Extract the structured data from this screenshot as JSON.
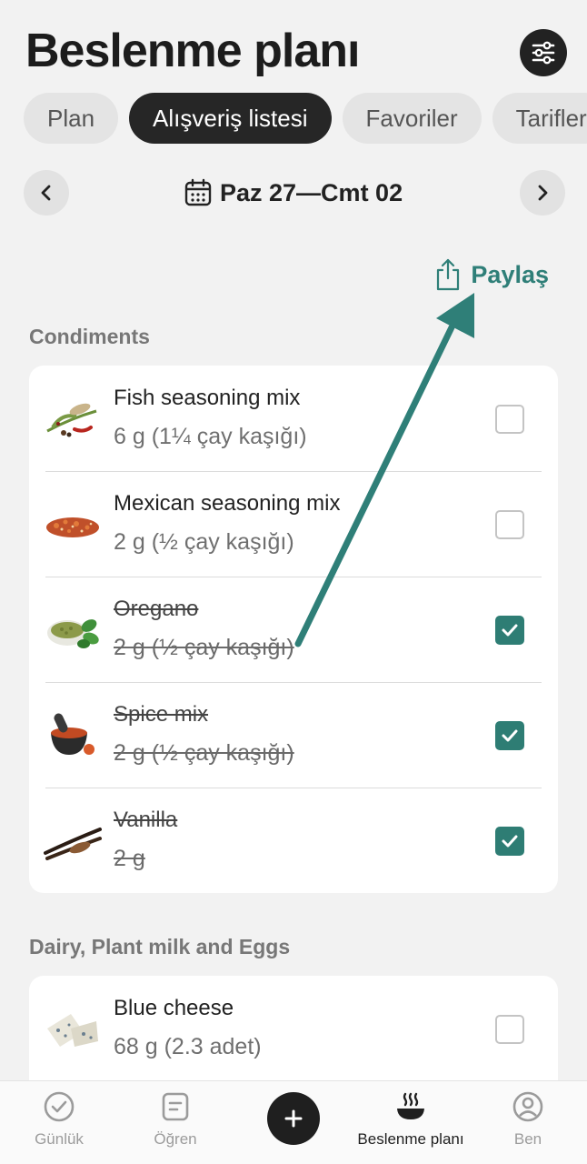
{
  "header": {
    "title": "Beslenme planı"
  },
  "tabs": [
    {
      "label": "Plan"
    },
    {
      "label": "Alışveriş listesi"
    },
    {
      "label": "Favoriler"
    },
    {
      "label": "Tarifler"
    }
  ],
  "week": {
    "range": "Paz 27—Cmt 02"
  },
  "share": {
    "label": "Paylaş"
  },
  "sections": [
    {
      "title": "Condiments",
      "items": [
        {
          "name": "Fish seasoning mix",
          "qty": "6 g (1¼ çay kaşığı)",
          "checked": false
        },
        {
          "name": "Mexican seasoning mix",
          "qty": "2 g (½ çay kaşığı)",
          "checked": false
        },
        {
          "name": "Oregano",
          "qty": "2 g (½ çay kaşığı)",
          "checked": true
        },
        {
          "name": "Spice mix",
          "qty": "2 g (½ çay kaşığı)",
          "checked": true
        },
        {
          "name": "Vanilla",
          "qty": "2 g",
          "checked": true
        }
      ]
    },
    {
      "title": "Dairy, Plant milk and Eggs",
      "items": [
        {
          "name": "Blue cheese",
          "qty": "68 g (2.3 adet)",
          "checked": false
        }
      ]
    }
  ],
  "bottom_nav": [
    {
      "label": "Günlük",
      "icon": "check-circle-icon"
    },
    {
      "label": "Öğren",
      "icon": "note-icon"
    },
    {
      "label": "",
      "icon": "plus-icon"
    },
    {
      "label": "Beslenme planı",
      "icon": "bowl-icon"
    },
    {
      "label": "Ben",
      "icon": "user-circle-icon"
    }
  ],
  "colors": {
    "accent": "#2e7d74",
    "dark": "#262626",
    "background": "#f2f2f2"
  }
}
